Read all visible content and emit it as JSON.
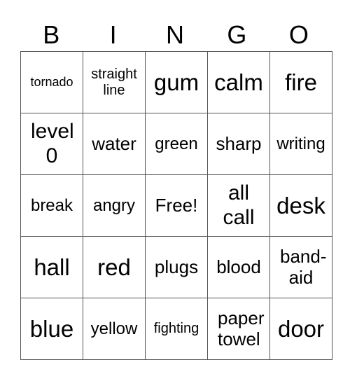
{
  "title_letters": [
    "B",
    "I",
    "N",
    "G",
    "O"
  ],
  "rows": [
    [
      "tornado",
      "straight line",
      "gum",
      "calm",
      "fire"
    ],
    [
      "level 0",
      "water",
      "green",
      "sharp",
      "writing"
    ],
    [
      "break",
      "angry",
      "Free!",
      "all call",
      "desk"
    ],
    [
      "hall",
      "red",
      "plugs",
      "blood",
      "band-aid"
    ],
    [
      "blue",
      "yellow",
      "fighting",
      "paper towel",
      "door"
    ]
  ]
}
